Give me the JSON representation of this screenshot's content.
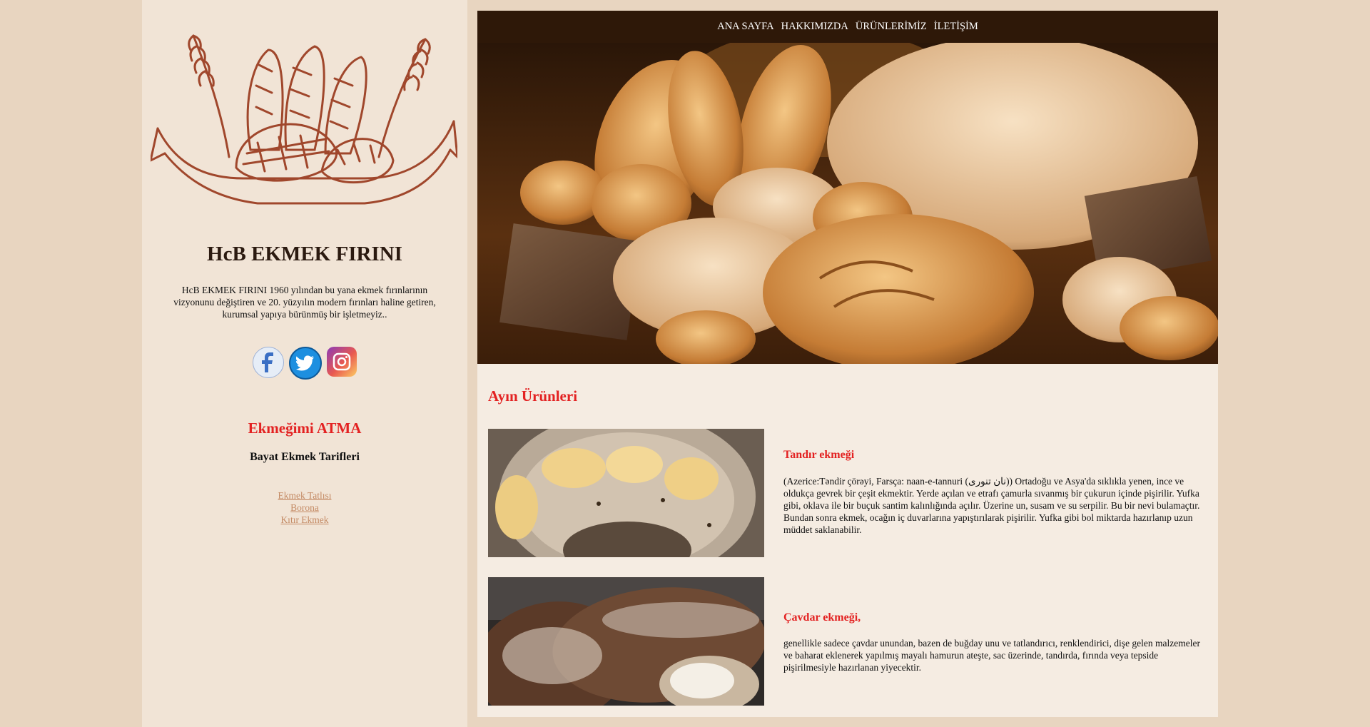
{
  "sidebar": {
    "brand": "HcB EKMEK FIRINI",
    "about": "HcB EKMEK FIRINI 1960 yılından bu yana ekmek fırınlarının vizyonunu değiştiren ve 20. yüzyılın modern fırınları haline getiren, kurumsal yapıya bürünmüş bir işletmeyiz..",
    "social": [
      {
        "name": "facebook",
        "glyph": "f"
      },
      {
        "name": "twitter",
        "glyph": "t"
      },
      {
        "name": "instagram",
        "glyph": "◎"
      }
    ],
    "slogan": "Ekmeğimi ATMA",
    "recipes_title": "Bayat Ekmek Tarifleri",
    "recipes": [
      "Ekmek Tatlısı",
      "Borona",
      "Kıtır Ekmek"
    ]
  },
  "nav": {
    "items": [
      "ANA SAYFA",
      "HAKKIMIZDA",
      "ÜRÜNLERİMİZ",
      "İLETİŞİM"
    ]
  },
  "main": {
    "section_title": "Ayın Ürünleri",
    "products": [
      {
        "title": "Tandır ekmeği",
        "desc": "(Azerice:Təndir çörəyi, Farsça: naan-e-tannuri (نان تنوری)) Ortadoğu ve Asya'da sıklıkla yenen, ince ve oldukça gevrek bir çeşit ekmektir. Yerde açılan ve etrafı çamurla sıvanmış bir çukurun içinde pişirilir. Yufka gibi, oklava ile bir buçuk santim kalınlığında açılır. Üzerine un, susam ve su serpilir. Bu bir nevi bulamaçtır. Bundan sonra ekmek, ocağın iç duvarlarına yapıştırılarak pişirilir. Yufka gibi bol miktarda hazırlanıp uzun müddet saklanabilir."
      },
      {
        "title": "Çavdar ekmeği,",
        "desc": "genellikle sadece çavdar unundan, bazen de buğday unu ve tatlandırıcı, renklendirici, dişe gelen malzemeler ve baharat eklenerek yapılmış mayalı hamurun ateşte, sac üzerinde, tandırda, fırında veya tepside pişirilmesiyle hazırlanan yiyecektir."
      }
    ]
  },
  "colors": {
    "page_bg": "#e8d5c0",
    "sidebar_bg": "#f1e4d6",
    "main_bg": "#f5ece2",
    "nav_bg": "#2e1808",
    "accent_red": "#e32222",
    "link": "#c48a64"
  }
}
